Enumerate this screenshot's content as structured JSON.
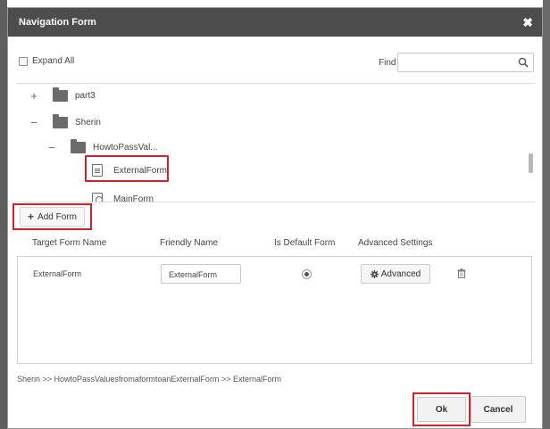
{
  "dialog": {
    "title": "Navigation Form",
    "close_glyph": "✖"
  },
  "toolbar": {
    "expand_all_label": "Expand All",
    "expand_all_checked": false,
    "find_label": "Find",
    "find_value": "",
    "find_placeholder": ""
  },
  "tree": {
    "nodes": [
      {
        "label": "part3",
        "type": "folder",
        "toggle": "+",
        "depth": 0
      },
      {
        "label": "Sherin",
        "type": "folder",
        "toggle": "−",
        "depth": 0
      },
      {
        "label": "HowtoPassVal...",
        "type": "folder",
        "toggle": "−",
        "depth": 1
      },
      {
        "label": "ExternalForm",
        "type": "form",
        "toggle": "",
        "depth": 2,
        "selected": true
      },
      {
        "label": "MainForm",
        "type": "form",
        "toggle": "",
        "depth": 2
      }
    ]
  },
  "add_form": {
    "label": "Add Form",
    "icon": "plus-icon"
  },
  "table": {
    "headers": {
      "target": "Target Form Name",
      "friendly": "Friendly Name",
      "default": "Is Default Form",
      "advanced": "Advanced Settings"
    },
    "rows": [
      {
        "target": "ExternalForm",
        "friendly": "ExternalForm",
        "is_default": true,
        "advanced_label": "Advanced"
      }
    ]
  },
  "breadcrumb": "Sherin >> HowtoPassValuesfromaformtoanExternalForm >> ExternalForm",
  "footer": {
    "ok_label": "Ok",
    "cancel_label": "Cancel"
  },
  "colors": {
    "titlebar": "#4d4d4d",
    "highlight": "#d4202a",
    "icon_gray": "#6b6b6b"
  }
}
